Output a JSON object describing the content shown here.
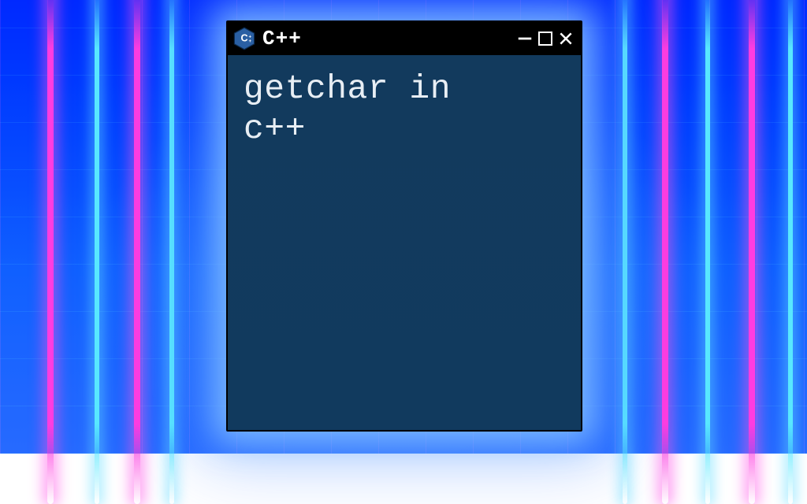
{
  "window": {
    "title": "C++",
    "icon": "cpp-logo-icon",
    "controls": {
      "minimize_glyph": "—",
      "maximize_glyph": "",
      "close_glyph": "×"
    }
  },
  "content": {
    "line1": "getchar in",
    "line2": "c++"
  },
  "colors": {
    "terminal_bg": "#133a5e",
    "titlebar_bg": "#000000",
    "text": "#e8eef4",
    "neon_pink": "#ff3ce0",
    "neon_cyan": "#58e8ff",
    "bg_blue": "#1a4afc"
  }
}
